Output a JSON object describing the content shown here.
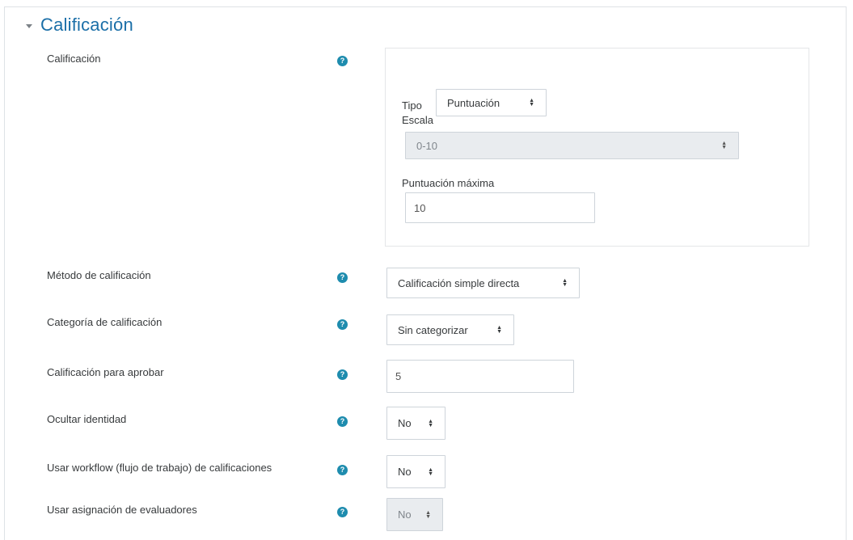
{
  "section": {
    "title": "Calificación"
  },
  "grade": {
    "label": "Calificación",
    "tipo_label": "Tipo",
    "tipo_value": "Puntuación",
    "escala_label": "Escala",
    "escala_value": "0-10",
    "max_label": "Puntuación máxima",
    "max_value": "10"
  },
  "fields": {
    "metodo": {
      "label": "Método de calificación",
      "value": "Calificación simple directa"
    },
    "categoria": {
      "label": "Categoría de calificación",
      "value": "Sin categorizar"
    },
    "aprobar": {
      "label": "Calificación para aprobar",
      "value": "5"
    },
    "ocultar": {
      "label": "Ocultar identidad",
      "value": "No"
    },
    "workflow": {
      "label": "Usar workflow (flujo de trabajo) de calificaciones",
      "value": "No"
    },
    "asignacion": {
      "label": "Usar asignación de evaluadores",
      "value": "No"
    }
  },
  "icons": {
    "help": "help-icon",
    "caret": "caret-down-icon",
    "select_arrow": "updown-arrows-icon"
  },
  "colors": {
    "accent": "#1b6fa8",
    "help_icon": "#1e8cae"
  }
}
